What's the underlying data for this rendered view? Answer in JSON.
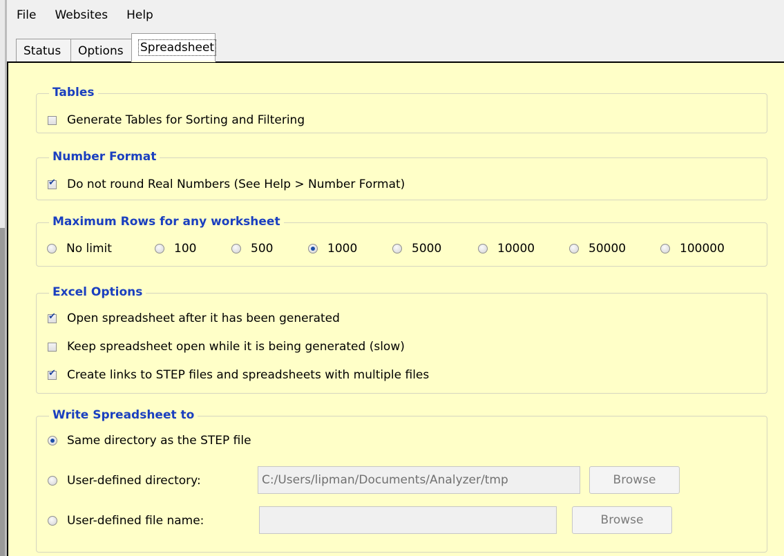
{
  "menu": [
    "File",
    "Websites",
    "Help"
  ],
  "tabs": [
    "Status",
    "Options",
    "Spreadsheet"
  ],
  "tables": {
    "title": "Tables",
    "generate_label": "Generate Tables for Sorting and Filtering",
    "generate_checked": false
  },
  "number_format": {
    "title": "Number Format",
    "no_round_label": "Do not round Real Numbers (See Help > Number Format)",
    "no_round_checked": true
  },
  "max_rows": {
    "title": "Maximum Rows for any worksheet",
    "options": [
      "No limit",
      "100",
      "500",
      "1000",
      "5000",
      "10000",
      "50000",
      "100000"
    ],
    "selected": "1000"
  },
  "excel_options": {
    "title": "Excel Options",
    "items": [
      {
        "label": "Open spreadsheet after it has been generated",
        "checked": true
      },
      {
        "label": "Keep spreadsheet open while it is being generated (slow)",
        "checked": false
      },
      {
        "label": "Create links to STEP files and spreadsheets with multiple files",
        "checked": true
      }
    ]
  },
  "write_to": {
    "title": "Write Spreadsheet to",
    "same_dir_label": "Same directory as the STEP file",
    "user_dir_label": "User-defined directory:",
    "user_dir_value": "C:/Users/lipman/Documents/Analyzer/tmp",
    "user_file_label": "User-defined file name:",
    "user_file_value": "",
    "browse_label": "Browse",
    "selected": "same_dir"
  }
}
